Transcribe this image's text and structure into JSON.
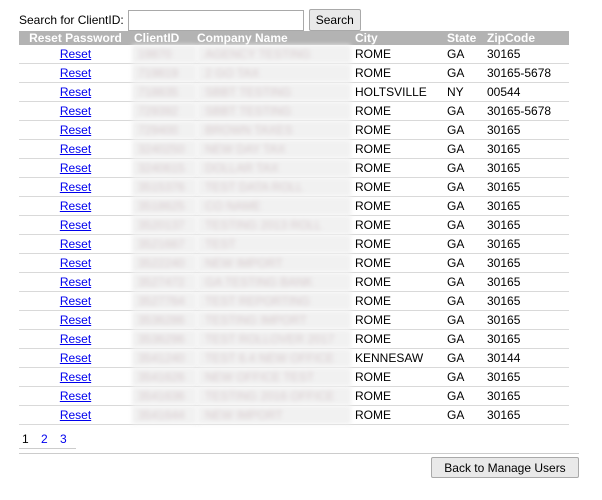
{
  "search": {
    "label": "Search for ClientID:",
    "value": "",
    "placeholder": "",
    "button_label": "Search"
  },
  "table": {
    "headers": {
      "reset": "Reset Password",
      "client_id": "ClientID",
      "company": "Company Name",
      "city": "City",
      "state": "State",
      "zip": "ZipCode"
    },
    "rows": [
      {
        "reset": "Reset",
        "client_id": "19870",
        "company": "AGENCY TESTING",
        "city": "ROME",
        "state": "GA",
        "zip": "30165"
      },
      {
        "reset": "Reset",
        "client_id": "719819",
        "company": "2 GO TAX",
        "city": "ROME",
        "state": "GA",
        "zip": "30165-5678"
      },
      {
        "reset": "Reset",
        "client_id": "718835",
        "company": "SBBT TESTING",
        "city": "HOLTSVILLE",
        "state": "NY",
        "zip": "00544"
      },
      {
        "reset": "Reset",
        "client_id": "729392",
        "company": "SBBT TESTING",
        "city": "ROME",
        "state": "GA",
        "zip": "30165-5678"
      },
      {
        "reset": "Reset",
        "client_id": "729400",
        "company": "BROWN TAXES",
        "city": "ROME",
        "state": "GA",
        "zip": "30165"
      },
      {
        "reset": "Reset",
        "client_id": "3240250",
        "company": "NEW DAY TAX",
        "city": "ROME",
        "state": "GA",
        "zip": "30165"
      },
      {
        "reset": "Reset",
        "client_id": "3240615",
        "company": "DOLLAR TAX",
        "city": "ROME",
        "state": "GA",
        "zip": "30165"
      },
      {
        "reset": "Reset",
        "client_id": "3515376",
        "company": "TEST DATA ROLL",
        "city": "ROME",
        "state": "GA",
        "zip": "30165"
      },
      {
        "reset": "Reset",
        "client_id": "3518625",
        "company": "CO NAME",
        "city": "ROME",
        "state": "GA",
        "zip": "30165"
      },
      {
        "reset": "Reset",
        "client_id": "3520137",
        "company": "TESTING 2013 ROLL",
        "city": "ROME",
        "state": "GA",
        "zip": "30165"
      },
      {
        "reset": "Reset",
        "client_id": "3521667",
        "company": "TEST",
        "city": "ROME",
        "state": "GA",
        "zip": "30165"
      },
      {
        "reset": "Reset",
        "client_id": "3522240",
        "company": "NEW IMPORT",
        "city": "ROME",
        "state": "GA",
        "zip": "30165"
      },
      {
        "reset": "Reset",
        "client_id": "3527472",
        "company": "GA TESTING BANK",
        "city": "ROME",
        "state": "GA",
        "zip": "30165"
      },
      {
        "reset": "Reset",
        "client_id": "3527764",
        "company": "TEST REPORTING",
        "city": "ROME",
        "state": "GA",
        "zip": "30165"
      },
      {
        "reset": "Reset",
        "client_id": "3536286",
        "company": "TESTING IMPORT",
        "city": "ROME",
        "state": "GA",
        "zip": "30165"
      },
      {
        "reset": "Reset",
        "client_id": "3536296",
        "company": "TEST ROLLOVER 2017",
        "city": "ROME",
        "state": "GA",
        "zip": "30165"
      },
      {
        "reset": "Reset",
        "client_id": "3541240",
        "company": "TEST 6.4 NEW OFFICE",
        "city": "KENNESAW",
        "state": "GA",
        "zip": "30144"
      },
      {
        "reset": "Reset",
        "client_id": "3541626",
        "company": "NEW OFFICE TEST",
        "city": "ROME",
        "state": "GA",
        "zip": "30165"
      },
      {
        "reset": "Reset",
        "client_id": "3541636",
        "company": "TESTING 2016 OFFICE",
        "city": "ROME",
        "state": "GA",
        "zip": "30165"
      },
      {
        "reset": "Reset",
        "client_id": "3541644",
        "company": "NEW IMPORT",
        "city": "ROME",
        "state": "GA",
        "zip": "30165"
      }
    ]
  },
  "pager": {
    "pages": [
      "1",
      "2",
      "3"
    ],
    "current": "1"
  },
  "footer": {
    "back_label": "Back to Manage Users"
  },
  "colors": {
    "header_bg": "#b3b3b3",
    "link": "#0000ee"
  }
}
